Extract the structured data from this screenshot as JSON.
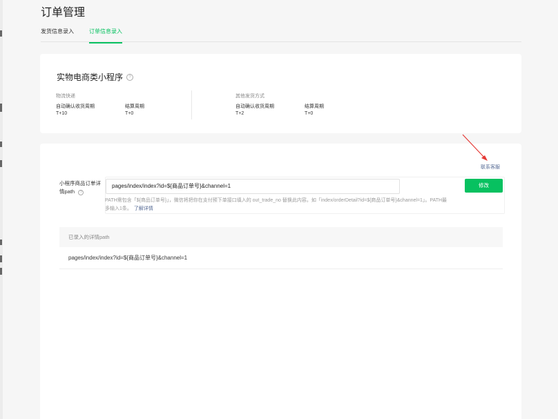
{
  "page": {
    "title": "订单管理"
  },
  "tabs": [
    {
      "label": "发货信息录入"
    },
    {
      "label": "订单信息录入"
    }
  ],
  "summary": {
    "title": "实物电商类小程序",
    "groups": [
      {
        "title": "物流快递",
        "items": [
          {
            "label": "自动确认收货周期",
            "value": "T+10"
          },
          {
            "label": "结算周期",
            "value": "T+0"
          }
        ]
      },
      {
        "title": "其他发货方式",
        "items": [
          {
            "label": "自动确认收货周期",
            "value": "T+2"
          },
          {
            "label": "结算周期",
            "value": "T+0"
          }
        ]
      }
    ]
  },
  "path_section": {
    "contact_label": "联系客服",
    "field_label": "小程序商品订单详情path",
    "input_value": "pages/index/index?id=${商品订单号}&channel=1",
    "modify_label": "修改",
    "hint": "PATH需包含「${商品订单号}」，微信将把你在支付预下单接口填入的 out_trade_no 替换此内容。如「index/orderDetail?id=${商品订单号}&channel=1」。PATH最多输入1条。",
    "hint_link": "了解详情",
    "table_header": "已录入的详情path",
    "rows": [
      "pages/index/index?id=${商品订单号}&channel=1"
    ]
  },
  "colors": {
    "accent": "#07c160",
    "link": "#576b95",
    "annotation_arrow": "#e53935"
  }
}
